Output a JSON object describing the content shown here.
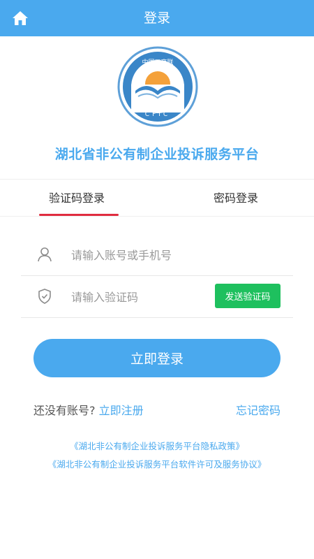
{
  "header": {
    "title": "登录",
    "home_icon": "home-icon"
  },
  "logo": {
    "top_text": "中国工商联",
    "bottom_text": "CFIC"
  },
  "platform_title": "湖北省非公有制企业投诉服务平台",
  "tabs": [
    {
      "label": "验证码登录",
      "active": true
    },
    {
      "label": "密码登录",
      "active": false
    }
  ],
  "form": {
    "account": {
      "placeholder": "请输入账号或手机号",
      "value": "",
      "icon": "user-icon"
    },
    "code": {
      "placeholder": "请输入验证码",
      "value": "",
      "icon": "shield-icon"
    },
    "send_code_label": "发送验证码"
  },
  "login_button": "立即登录",
  "register": {
    "prompt": "还没有账号?",
    "link": "立即注册"
  },
  "forgot_password": "忘记密码",
  "policies": [
    "《湖北非公有制企业投诉服务平台隐私政策》",
    "《湖北非公有制企业投诉服务平台软件许可及服务协议》"
  ],
  "colors": {
    "primary": "#4aa9ee",
    "send_button": "#1ec05e",
    "tab_underline": "#e02c3f"
  }
}
